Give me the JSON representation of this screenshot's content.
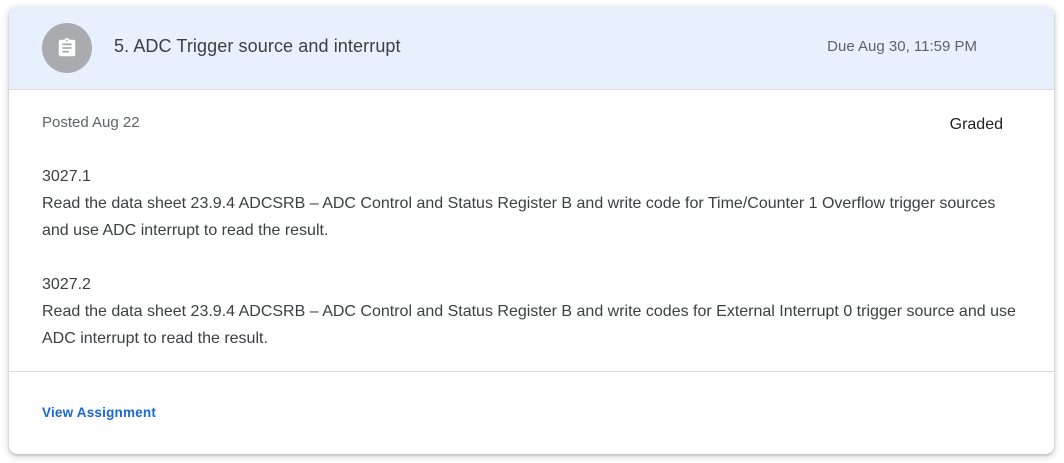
{
  "assignment": {
    "icon": "assignment-icon",
    "title": "5. ADC Trigger source and interrupt",
    "due": "Due Aug 30, 11:59 PM",
    "posted": "Posted Aug 22",
    "status": "Graded",
    "description": [
      {
        "id": "3027.1",
        "text": "Read the data sheet 23.9.4 ADCSRB – ADC Control and Status Register B and write code for Time/Counter 1 Overflow trigger sources and use ADC interrupt to read the result."
      },
      {
        "id": "3027.2",
        "text": "Read the data sheet 23.9.4 ADCSRB – ADC Control and Status Register B and write codes for External Interrupt 0 trigger source and use ADC interrupt to read the result."
      }
    ],
    "view_label": "View Assignment"
  },
  "colors": {
    "header_bg": "#e8f0fe",
    "icon_bg": "#a9abae",
    "link": "#1967d2"
  }
}
